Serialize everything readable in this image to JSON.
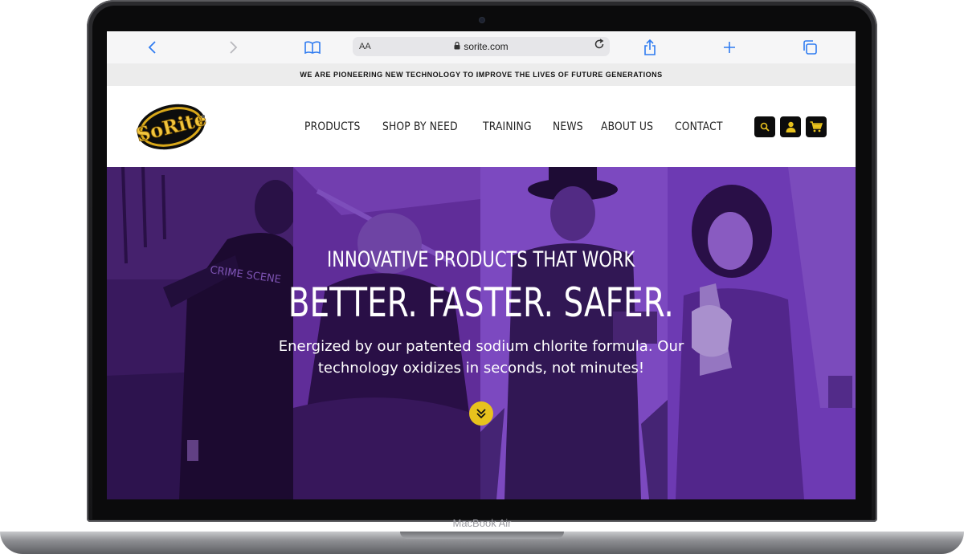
{
  "device": {
    "model_label": "MacBook Air"
  },
  "browser": {
    "text_size_label": "AA",
    "url": "sorite.com",
    "icons": [
      "back-icon",
      "forward-icon",
      "reader-icon",
      "lock-icon",
      "reload-icon",
      "share-icon",
      "new-tab-icon",
      "tabs-icon"
    ]
  },
  "announcement": {
    "text": "WE ARE PIONEERING NEW TECHNOLOGY TO IMPROVE THE LIVES OF FUTURE GENERATIONS"
  },
  "header": {
    "logo_text": "SoRite",
    "nav": [
      {
        "label": "PRODUCTS"
      },
      {
        "label": "SHOP BY NEED"
      },
      {
        "label": "TRAINING"
      },
      {
        "label": "NEWS"
      },
      {
        "label": "ABOUT US"
      },
      {
        "label": "CONTACT"
      }
    ],
    "icons": [
      "search-icon",
      "account-icon",
      "cart-icon"
    ]
  },
  "hero": {
    "title": "INNOVATIVE PRODUCTS THAT WORK",
    "headline": "BETTER. FASTER. SAFER.",
    "copy_line1": "Energized by our patented sodium chlorite formula. Our",
    "copy_line2": "technology oxidizes in seconds, not minutes!",
    "panel_label": "CRIME SCENE"
  },
  "colors": {
    "accent_yellow": "#e8c21d",
    "hero_purple": "#5b2a8f",
    "link_blue": "#2f7bf0",
    "header_button": "#0c0c0c"
  }
}
